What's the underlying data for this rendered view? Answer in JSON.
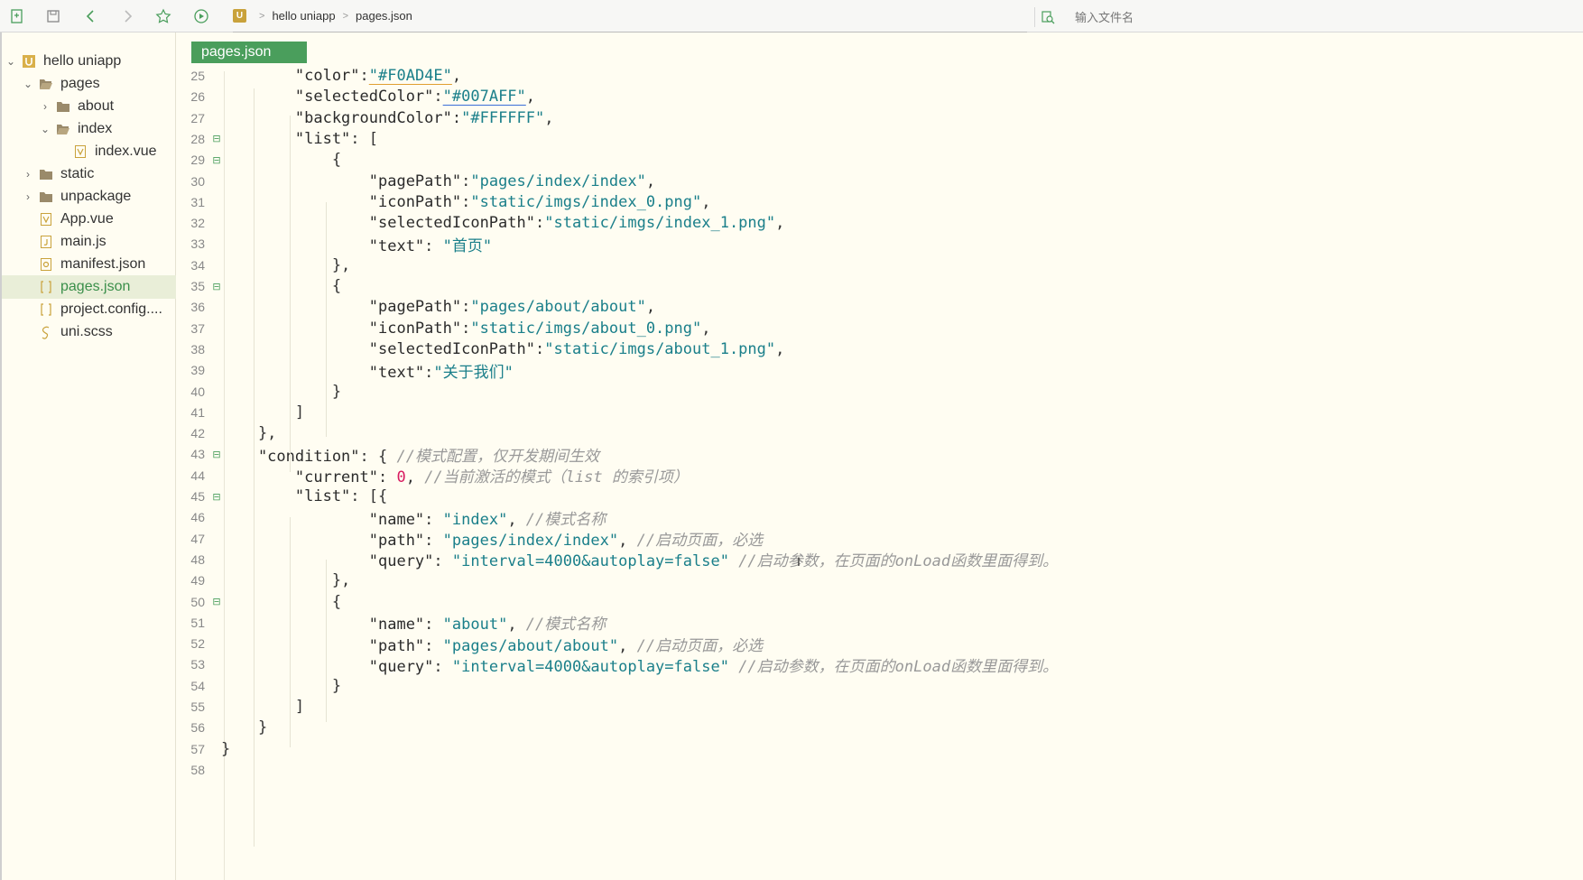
{
  "toolbar": {
    "icons": [
      "new-file-icon",
      "save-icon",
      "back-icon",
      "forward-icon",
      "star-icon",
      "run-icon"
    ]
  },
  "breadcrumb": {
    "logo": "U",
    "project": "hello uniapp",
    "file": "pages.json"
  },
  "search": {
    "placeholder": "输入文件名"
  },
  "sidebar": {
    "items": [
      {
        "label": "hello uniapp",
        "icon": "project-icon",
        "caret": "expanded",
        "indent": 0
      },
      {
        "label": "pages",
        "icon": "folder-open-icon",
        "caret": "expanded",
        "indent": 1
      },
      {
        "label": "about",
        "icon": "folder-icon",
        "caret": "collapsed",
        "indent": 2
      },
      {
        "label": "index",
        "icon": "folder-open-icon",
        "caret": "expanded",
        "indent": 2
      },
      {
        "label": "index.vue",
        "icon": "vue-file-icon",
        "caret": "none",
        "indent": 3
      },
      {
        "label": "static",
        "icon": "folder-icon",
        "caret": "collapsed",
        "indent": 1
      },
      {
        "label": "unpackage",
        "icon": "folder-icon",
        "caret": "collapsed",
        "indent": 1
      },
      {
        "label": "App.vue",
        "icon": "vue-file-icon",
        "caret": "none",
        "indent": 1
      },
      {
        "label": "main.js",
        "icon": "js-file-icon",
        "caret": "none",
        "indent": 1
      },
      {
        "label": "manifest.json",
        "icon": "manifest-file-icon",
        "caret": "none",
        "indent": 1
      },
      {
        "label": "pages.json",
        "icon": "json-file-icon",
        "caret": "none",
        "indent": 1,
        "selected": true
      },
      {
        "label": "project.config....",
        "icon": "json-file-icon",
        "caret": "none",
        "indent": 1
      },
      {
        "label": "uni.scss",
        "icon": "scss-file-icon",
        "caret": "none",
        "indent": 1
      }
    ]
  },
  "editor": {
    "tab_label": "pages.json",
    "lines": [
      {
        "n": "25",
        "fold": "",
        "t": [
          [
            "k",
            "        \"color\""
          ],
          [
            "p",
            ":"
          ],
          [
            "s",
            "\"#F0AD4E\""
          ],
          [
            "p",
            ","
          ]
        ]
      },
      {
        "n": "26",
        "fold": "",
        "t": [
          [
            "k",
            "        \"selectedColor\""
          ],
          [
            "p",
            ":"
          ],
          [
            "s",
            "\"#007AFF\""
          ],
          [
            "p",
            ","
          ]
        ]
      },
      {
        "n": "27",
        "fold": "",
        "t": [
          [
            "k",
            "        \"backgroundColor\""
          ],
          [
            "p",
            ":"
          ],
          [
            "s",
            "\"#FFFFFF\""
          ],
          [
            "p",
            ","
          ]
        ]
      },
      {
        "n": "28",
        "fold": "⊟",
        "t": [
          [
            "k",
            "        \"list\""
          ],
          [
            "p",
            ": ["
          ]
        ]
      },
      {
        "n": "29",
        "fold": "⊟",
        "t": [
          [
            "p",
            "            {"
          ]
        ]
      },
      {
        "n": "30",
        "fold": "",
        "t": [
          [
            "k",
            "                \"pagePath\""
          ],
          [
            "p",
            ":"
          ],
          [
            "s",
            "\"pages/index/index\""
          ],
          [
            "p",
            ","
          ]
        ]
      },
      {
        "n": "31",
        "fold": "",
        "t": [
          [
            "k",
            "                \"iconPath\""
          ],
          [
            "p",
            ":"
          ],
          [
            "s",
            "\"static/imgs/index_0.png\""
          ],
          [
            "p",
            ","
          ]
        ]
      },
      {
        "n": "32",
        "fold": "",
        "t": [
          [
            "k",
            "                \"selectedIconPath\""
          ],
          [
            "p",
            ":"
          ],
          [
            "s",
            "\"static/imgs/index_1.png\""
          ],
          [
            "p",
            ","
          ]
        ]
      },
      {
        "n": "33",
        "fold": "",
        "t": [
          [
            "k",
            "                \"text\""
          ],
          [
            "p",
            ": "
          ],
          [
            "s",
            "\"首页\""
          ]
        ]
      },
      {
        "n": "34",
        "fold": "",
        "t": [
          [
            "p",
            "            },"
          ]
        ]
      },
      {
        "n": "35",
        "fold": "⊟",
        "t": [
          [
            "p",
            "            {"
          ]
        ]
      },
      {
        "n": "36",
        "fold": "",
        "t": [
          [
            "k",
            "                \"pagePath\""
          ],
          [
            "p",
            ":"
          ],
          [
            "s",
            "\"pages/about/about\""
          ],
          [
            "p",
            ","
          ]
        ]
      },
      {
        "n": "37",
        "fold": "",
        "t": [
          [
            "k",
            "                \"iconPath\""
          ],
          [
            "p",
            ":"
          ],
          [
            "s",
            "\"static/imgs/about_0.png\""
          ],
          [
            "p",
            ","
          ]
        ]
      },
      {
        "n": "38",
        "fold": "",
        "t": [
          [
            "k",
            "                \"selectedIconPath\""
          ],
          [
            "p",
            ":"
          ],
          [
            "s",
            "\"static/imgs/about_1.png\""
          ],
          [
            "p",
            ","
          ]
        ]
      },
      {
        "n": "39",
        "fold": "",
        "t": [
          [
            "k",
            "                \"text\""
          ],
          [
            "p",
            ":"
          ],
          [
            "s",
            "\"关于我们\""
          ]
        ]
      },
      {
        "n": "40",
        "fold": "",
        "t": [
          [
            "p",
            "            }"
          ]
        ]
      },
      {
        "n": "41",
        "fold": "",
        "t": [
          [
            "p",
            "        ]"
          ]
        ]
      },
      {
        "n": "42",
        "fold": "",
        "t": [
          [
            "p",
            "    },"
          ]
        ]
      },
      {
        "n": "43",
        "fold": "⊟",
        "t": [
          [
            "k",
            "    \"condition\""
          ],
          [
            "p",
            ": { "
          ],
          [
            "c",
            "//模式配置，仅开发期间生效"
          ]
        ]
      },
      {
        "n": "44",
        "fold": "",
        "t": [
          [
            "k",
            "        \"current\""
          ],
          [
            "p",
            ": "
          ],
          [
            "n",
            "0"
          ],
          [
            "p",
            ", "
          ],
          [
            "c",
            "//当前激活的模式（list 的索引项）"
          ]
        ]
      },
      {
        "n": "45",
        "fold": "⊟",
        "t": [
          [
            "k",
            "        \"list\""
          ],
          [
            "p",
            ": [{"
          ]
        ]
      },
      {
        "n": "46",
        "fold": "",
        "t": [
          [
            "k",
            "                \"name\""
          ],
          [
            "p",
            ": "
          ],
          [
            "s",
            "\"index\""
          ],
          [
            "p",
            ", "
          ],
          [
            "c",
            "//模式名称"
          ]
        ]
      },
      {
        "n": "47",
        "fold": "",
        "t": [
          [
            "k",
            "                \"path\""
          ],
          [
            "p",
            ": "
          ],
          [
            "s",
            "\"pages/index/index\""
          ],
          [
            "p",
            ", "
          ],
          [
            "c",
            "//启动页面，必选"
          ]
        ]
      },
      {
        "n": "48",
        "fold": "",
        "t": [
          [
            "k",
            "                \"query\""
          ],
          [
            "p",
            ": "
          ],
          [
            "s",
            "\"interval=4000&autoplay=false\""
          ],
          [
            "p",
            " "
          ],
          [
            "c",
            "//启动参数，在页面的onLoad函数里面得到。"
          ]
        ]
      },
      {
        "n": "49",
        "fold": "",
        "t": [
          [
            "p",
            "            },"
          ]
        ]
      },
      {
        "n": "50",
        "fold": "⊟",
        "t": [
          [
            "p",
            "            {"
          ]
        ]
      },
      {
        "n": "51",
        "fold": "",
        "t": [
          [
            "k",
            "                \"name\""
          ],
          [
            "p",
            ": "
          ],
          [
            "s",
            "\"about\""
          ],
          [
            "p",
            ", "
          ],
          [
            "c",
            "//模式名称"
          ]
        ]
      },
      {
        "n": "52",
        "fold": "",
        "t": [
          [
            "k",
            "                \"path\""
          ],
          [
            "p",
            ": "
          ],
          [
            "s",
            "\"pages/about/about\""
          ],
          [
            "p",
            ", "
          ],
          [
            "c",
            "//启动页面，必选"
          ]
        ]
      },
      {
        "n": "53",
        "fold": "",
        "t": [
          [
            "k",
            "                \"query\""
          ],
          [
            "p",
            ": "
          ],
          [
            "s",
            "\"interval=4000&autoplay=false\""
          ],
          [
            "p",
            " "
          ],
          [
            "c",
            "//启动参数，在页面的onLoad函数里面得到。"
          ]
        ]
      },
      {
        "n": "54",
        "fold": "",
        "t": [
          [
            "p",
            "            }"
          ]
        ]
      },
      {
        "n": "55",
        "fold": "",
        "t": [
          [
            "p",
            "        ]"
          ]
        ]
      },
      {
        "n": "56",
        "fold": "",
        "t": [
          [
            "p",
            "    }"
          ]
        ]
      },
      {
        "n": "57",
        "fold": "",
        "t": [
          [
            "p",
            "}"
          ]
        ]
      },
      {
        "n": "58",
        "fold": "",
        "t": []
      }
    ]
  },
  "colors": {
    "accent": "#4a9e5c",
    "editor_bg": "#fffdf2",
    "string": "#1a7f8a",
    "number": "#d81b60",
    "comment": "#999999"
  }
}
